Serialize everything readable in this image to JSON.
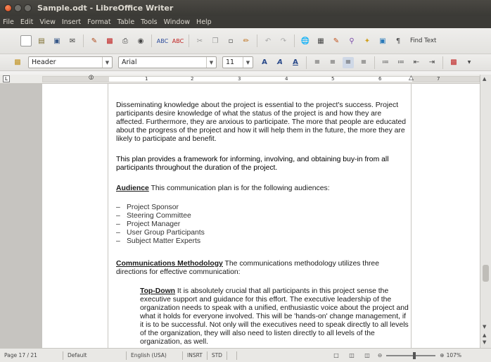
{
  "window": {
    "title": "Sample.odt - LibreOffice Writer"
  },
  "menubar": {
    "items": [
      "File",
      "Edit",
      "View",
      "Insert",
      "Format",
      "Table",
      "Tools",
      "Window",
      "Help"
    ]
  },
  "toolbar1": {
    "find_text_label": "Find Text"
  },
  "toolbar2": {
    "paragraph_style": "Header",
    "font_name": "Arial",
    "font_size": "11"
  },
  "ruler": {
    "numbers": [
      "1",
      "2",
      "3",
      "4",
      "5",
      "6",
      "7"
    ]
  },
  "document": {
    "p1": "Disseminating knowledge about the project is essential to the project's success. Project participants desire knowledge of what the status of the project is and how they are affected. Furthermore, they are anxious to participate. The more that people are educated about the progress of the project and how it will help them in the future, the more they are likely to participate and benefit.",
    "p2": "This plan provides a framework for informing, involving, and obtaining buy-in from all participants throughout the duration of the project.",
    "p3_heading": "Audience",
    "p3_text": " This communication plan is for the following audiences:",
    "bullets": [
      "Project Sponsor",
      "Steering Committee",
      "Project Manager",
      "User Group Participants",
      "Subject Matter Experts"
    ],
    "p4_heading": "Communications Methodology",
    "p4_text": " The communications methodology utilizes three directions for effective communication:",
    "p5_heading": "Top-Down",
    "p5_text": " It is absolutely crucial that all participants in this project sense the executive support and guidance for this effort. The executive leadership of the organization needs to speak with a unified, enthusiastic voice about the project and what it holds for everyone involved. This will be 'hands-on' change management, if it is to be successful. Not only will the executives need to speak directly to all levels of the organization, they will also need to listen directly to all levels of the organization, as well."
  },
  "statusbar": {
    "page": "Page 17 / 21",
    "style": "Default",
    "language": "English (USA)",
    "insert": "INSRT",
    "selection": "STD",
    "zoom": "107%"
  }
}
